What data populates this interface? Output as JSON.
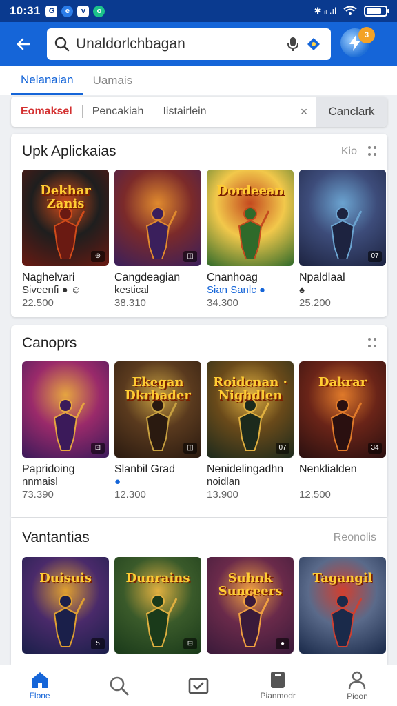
{
  "status_bar": {
    "time": "10:31",
    "left_icons": [
      "G",
      "e",
      "v",
      "o"
    ],
    "right_text": "✱ ᵢₗ .ıl",
    "battery_level": 0.8
  },
  "app_bar": {
    "search_text": "Unaldorlchbagan",
    "avatar_badge": "3"
  },
  "tabs": [
    {
      "label": "Nelanaian",
      "active": true
    },
    {
      "label": "Uamais",
      "active": false
    }
  ],
  "filter": {
    "chips": [
      {
        "label": "Eomaksel",
        "active": true
      },
      {
        "label": "Pencakiah",
        "active": false
      },
      {
        "label": "Iistairlein",
        "active": false
      }
    ],
    "clear_symbol": "×",
    "cancel_label": "Canclark"
  },
  "sections": [
    {
      "title": "Upk Aplickaias",
      "link": "Kio",
      "cards": [
        {
          "art": "Dekhar Zanis",
          "badge": "⊛",
          "name": "Naghelvari",
          "sub": "Siveenfi ● ☺",
          "sub_blue": false,
          "count": "22.500",
          "colors": [
            "#6a1a12",
            "#1e1e1e",
            "#d04b1a"
          ]
        },
        {
          "art": "",
          "badge": "◫",
          "name": "Cangdeagian",
          "sub": "kestical",
          "sub_blue": false,
          "count": "38.310",
          "colors": [
            "#3a1f5c",
            "#7b2a2a",
            "#e08a2e"
          ]
        },
        {
          "art": "Dordeean",
          "badge": "",
          "name": "Cnanhoag",
          "sub": "Sian Sanlc ●",
          "sub_blue": true,
          "count": "34.300",
          "colors": [
            "#2f6a2a",
            "#f2c84b",
            "#c44a1f"
          ]
        },
        {
          "art": "",
          "badge": "07",
          "name": "Npaldlaal",
          "sub": "♠",
          "sub_blue": false,
          "count": "25.200",
          "colors": [
            "#1d2340",
            "#3d4c7a",
            "#6ba3d0"
          ]
        }
      ]
    },
    {
      "title": "Canoprs",
      "link": "",
      "cards": [
        {
          "art": "",
          "badge": "⊡",
          "name": "Papridoing",
          "sub": "nnmaisl",
          "sub_blue": false,
          "count": "73.390",
          "colors": [
            "#3b1a5a",
            "#9a2a6a",
            "#e6a540"
          ]
        },
        {
          "art": "Ekegan Dkrhader",
          "badge": "◫",
          "name": "Slanbil Grad",
          "sub": "●",
          "sub_blue": true,
          "count": "12.300",
          "colors": [
            "#2a1a10",
            "#5a3a1e",
            "#c7a040"
          ]
        },
        {
          "art": "Roidcnan · Nighdlen",
          "badge": "07",
          "name": "Nenidelingadhn",
          "sub": "noidlan",
          "sub_blue": false,
          "count": "13.900",
          "colors": [
            "#1c2a1c",
            "#6a4a1a",
            "#e0b040"
          ]
        },
        {
          "art": "Dakrar",
          "badge": "34",
          "name": "Nenklialden",
          "sub": "",
          "sub_blue": false,
          "count": "12.500",
          "colors": [
            "#2a1010",
            "#6a2418",
            "#e07a2a"
          ]
        }
      ]
    },
    {
      "title": "Vantantias",
      "link": "Reonolis",
      "cards": [
        {
          "art": "Duisuis",
          "badge": "5",
          "name": "",
          "sub": "",
          "sub_blue": false,
          "count": "",
          "colors": [
            "#1a1f4a",
            "#4a2a6a",
            "#e0a030"
          ]
        },
        {
          "art": "Dunrains",
          "badge": "⊟",
          "name": "",
          "sub": "",
          "sub_blue": false,
          "count": "",
          "colors": [
            "#1a3a1a",
            "#3a5a2a",
            "#e0b040"
          ]
        },
        {
          "art": "Suhnk Sunceers",
          "badge": "●",
          "name": "",
          "sub": "",
          "sub_blue": false,
          "count": "",
          "colors": [
            "#3a1a3a",
            "#6a2a4a",
            "#f0a040"
          ]
        },
        {
          "art": "Tagangil",
          "badge": "",
          "name": "",
          "sub": "",
          "sub_blue": false,
          "count": "",
          "colors": [
            "#1a2a4a",
            "#5a6a8a",
            "#d04030"
          ]
        }
      ]
    }
  ],
  "bottom_nav": [
    {
      "label": "Flone",
      "icon": "home-icon",
      "active": true
    },
    {
      "label": "",
      "icon": "search-icon",
      "active": false
    },
    {
      "label": "",
      "icon": "inbox-icon",
      "active": false
    },
    {
      "label": "Pianmodr",
      "icon": "device-icon",
      "active": false
    },
    {
      "label": "Pioon",
      "icon": "profile-icon",
      "active": false
    }
  ]
}
